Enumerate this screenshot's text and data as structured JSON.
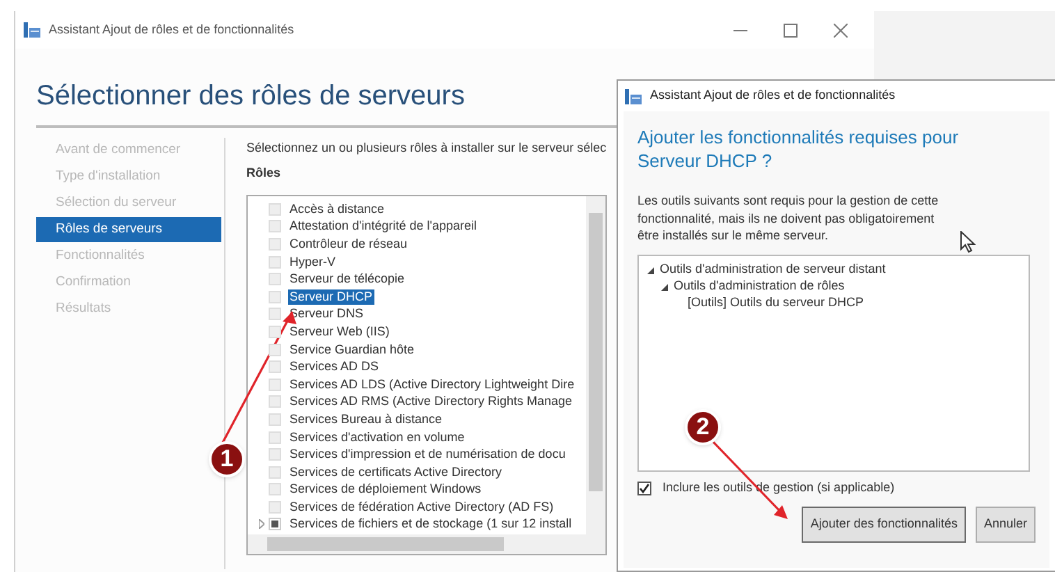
{
  "window": {
    "title": "Assistant Ajout de rôles et de fonctionnalités",
    "heading": "Sélectionner des rôles de serveurs"
  },
  "sidebar": {
    "items": [
      {
        "label": "Avant de commencer",
        "selected": false
      },
      {
        "label": "Type d'installation",
        "selected": false
      },
      {
        "label": "Sélection du serveur",
        "selected": false
      },
      {
        "label": "Rôles de serveurs",
        "selected": true
      },
      {
        "label": "Fonctionnalités",
        "selected": false
      },
      {
        "label": "Confirmation",
        "selected": false
      },
      {
        "label": "Résultats",
        "selected": false
      }
    ]
  },
  "content": {
    "instruction": "Sélectionnez un ou plusieurs rôles à installer sur le serveur sélec",
    "roles_label": "Rôles",
    "roles": [
      {
        "label": "Accès à distance",
        "kind": "leaf",
        "checked": false,
        "selected": false
      },
      {
        "label": "Attestation d'intégrité de l'appareil",
        "kind": "leaf",
        "checked": false,
        "selected": false
      },
      {
        "label": "Contrôleur de réseau",
        "kind": "leaf",
        "checked": false,
        "selected": false
      },
      {
        "label": "Hyper-V",
        "kind": "leaf",
        "checked": false,
        "selected": false
      },
      {
        "label": "Serveur de télécopie",
        "kind": "leaf",
        "checked": false,
        "selected": false
      },
      {
        "label": "Serveur DHCP",
        "kind": "leaf",
        "checked": false,
        "selected": true
      },
      {
        "label": "Serveur DNS",
        "kind": "leaf",
        "checked": false,
        "selected": false
      },
      {
        "label": "Serveur Web (IIS)",
        "kind": "leaf",
        "checked": false,
        "selected": false
      },
      {
        "label": "Service Guardian hôte",
        "kind": "leaf",
        "checked": false,
        "selected": false
      },
      {
        "label": "Services AD DS",
        "kind": "leaf",
        "checked": false,
        "selected": false
      },
      {
        "label": "Services AD LDS (Active Directory Lightweight Dire",
        "kind": "leaf",
        "checked": false,
        "selected": false
      },
      {
        "label": "Services AD RMS (Active Directory Rights Manage",
        "kind": "leaf",
        "checked": false,
        "selected": false
      },
      {
        "label": "Services Bureau à distance",
        "kind": "leaf",
        "checked": false,
        "selected": false
      },
      {
        "label": "Services d'activation en volume",
        "kind": "leaf",
        "checked": false,
        "selected": false
      },
      {
        "label": "Services d'impression et de numérisation de docu",
        "kind": "leaf",
        "checked": false,
        "selected": false
      },
      {
        "label": "Services de certificats Active Directory",
        "kind": "leaf",
        "checked": false,
        "selected": false
      },
      {
        "label": "Services de déploiement Windows",
        "kind": "leaf",
        "checked": false,
        "selected": false
      },
      {
        "label": "Services de fédération Active Directory (AD FS)",
        "kind": "leaf",
        "checked": false,
        "selected": false
      },
      {
        "label": "Services de fichiers et de stockage (1 sur 12 install",
        "kind": "group",
        "indeterminate": true,
        "selected": false
      }
    ]
  },
  "dialog": {
    "title": "Assistant Ajout de rôles et de fonctionnalités",
    "heading": "Ajouter les fonctionnalités requises pour Serveur DHCP ?",
    "description": "Les outils suivants sont requis pour la gestion de cette fonctionnalité, mais ils ne doivent pas obligatoirement être installés sur le même serveur.",
    "tree": [
      {
        "label": "Outils d'administration de serveur distant",
        "children": [
          {
            "label": "Outils d'administration de rôles",
            "children": [
              {
                "label": "[Outils] Outils du serveur DHCP"
              }
            ]
          }
        ]
      }
    ],
    "include_tools": {
      "label": "Inclure les outils de gestion (si applicable)",
      "checked": true
    },
    "buttons": [
      {
        "label": "Ajouter des fonctionnalités",
        "selected": true
      },
      {
        "label": "Annuler",
        "selected": false
      }
    ]
  },
  "callouts": [
    {
      "number": "1"
    },
    {
      "number": "2"
    }
  ]
}
